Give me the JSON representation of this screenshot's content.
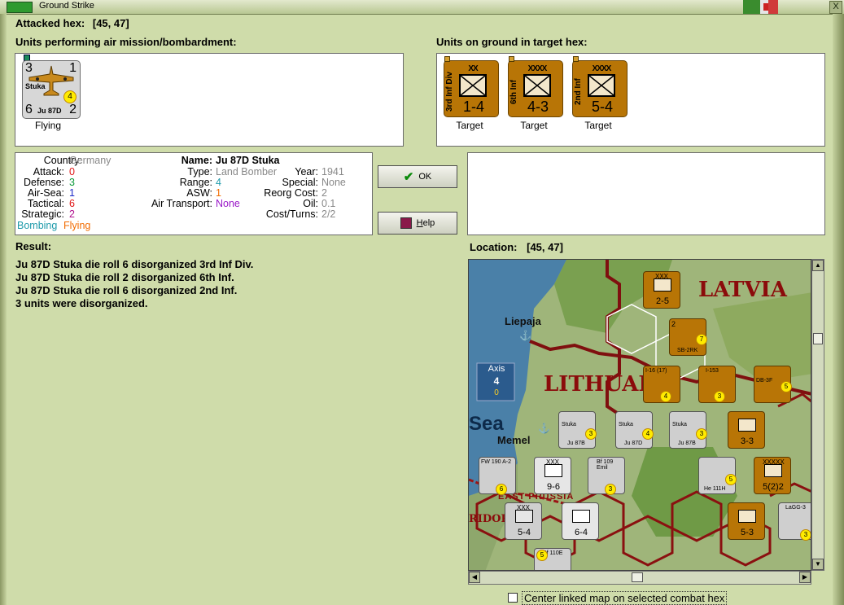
{
  "window": {
    "title": "Ground Strike",
    "close": "X"
  },
  "header": {
    "attacked_label": "Attacked hex:",
    "attacked_hex": "[45, 47]"
  },
  "air_panel": {
    "label": "Units performing air mission/bombardment:",
    "unit": {
      "name": "Stuka",
      "model": "Ju 87D",
      "top_left": "3",
      "top_right": "1",
      "bottom_left": "6",
      "bottom_right": "2",
      "range_badge": "4",
      "caption": "Flying"
    }
  },
  "ground_panel": {
    "label": "Units on ground in target hex:",
    "units": [
      {
        "side": "3rd Inf Div",
        "size": "XX",
        "strength": "1-4",
        "caption": "Target"
      },
      {
        "side": "6th Inf",
        "size": "XXXX",
        "strength": "4-3",
        "caption": "Target"
      },
      {
        "side": "2nd Inf",
        "size": "XXXX",
        "strength": "5-4",
        "caption": "Target"
      }
    ]
  },
  "info": {
    "country_label": "Country:",
    "country": "Germany",
    "attack_label": "Attack:",
    "attack": "0",
    "defense_label": "Defense:",
    "defense": "3",
    "airsea_label": "Air-Sea:",
    "airsea": "1",
    "tactical_label": "Tactical:",
    "tactical": "6",
    "strategic_label": "Strategic:",
    "strategic": "2",
    "status_a": "Bombing",
    "status_b": "Flying",
    "name_label": "Name:",
    "name": "Ju 87D Stuka",
    "type_label": "Type:",
    "type": "Land Bomber",
    "range_label": "Range:",
    "range": "4",
    "asw_label": "ASW:",
    "asw": "1",
    "airtransport_label": "Air Transport:",
    "airtransport": "None",
    "year_label": "Year:",
    "year": "1941",
    "special_label": "Special:",
    "special": "None",
    "reorg_label": "Reorg Cost:",
    "reorg": "2",
    "oil_label": "Oil:",
    "oil": "0.1",
    "cost_label": "Cost/Turns:",
    "cost": "2/2"
  },
  "buttons": {
    "ok": "OK",
    "help_h": "H",
    "help_rest": "elp"
  },
  "result": {
    "label": "Result:",
    "lines": [
      "Ju 87D Stuka die roll 6 disorganized 3rd Inf Div.",
      "Ju 87D Stuka die roll 2 disorganized 6th Inf.",
      "Ju 87D Stuka die roll 6 disorganized 2nd Inf.",
      "3 units were disorganized."
    ]
  },
  "location": {
    "label": "Location:",
    "hex": "[45, 47]"
  },
  "map": {
    "labels": {
      "latvia": "LATVIA",
      "lithuania": "LITHUAI",
      "sea": "Sea",
      "liepaja": "Liepaja",
      "memel": "Memel",
      "axis": "Axis",
      "axis_num": "4",
      "axis_zero": "0",
      "east_prussia": "EAST PRUSSIA",
      "corridor": "RIDOR"
    },
    "counters": [
      {
        "id": "c1",
        "top": "XXX",
        "val": "2-5"
      },
      {
        "id": "c2",
        "top": "2",
        "model": "SB-2RK",
        "badge": "7"
      },
      {
        "id": "c3",
        "model": "I-16 (17)",
        "badge": "4"
      },
      {
        "id": "c4",
        "model": "I-153",
        "badge": "3"
      },
      {
        "id": "c5",
        "model": "DB-3F",
        "badge": "5"
      },
      {
        "id": "c6",
        "name": "Stuka",
        "model": "Ju 87B",
        "badge": "3"
      },
      {
        "id": "c7",
        "name": "Stuka",
        "model": "Ju 87D",
        "badge": "4"
      },
      {
        "id": "c8",
        "name": "Stuka",
        "model": "Ju 87B",
        "badge": "3"
      },
      {
        "id": "c9",
        "val": "3-3"
      },
      {
        "id": "c10",
        "model": "FW 190 A-2",
        "badge": "6"
      },
      {
        "id": "c11",
        "top": "XXX",
        "val": "9-6"
      },
      {
        "id": "c12",
        "model": "Bf 109 Emil",
        "badge": "3"
      },
      {
        "id": "c13",
        "model": "He 111H",
        "badge": "5"
      },
      {
        "id": "c14",
        "top": "XXXXX",
        "val": "5(2)2"
      },
      {
        "id": "c15",
        "top": "XXX",
        "val": "5-4"
      },
      {
        "id": "c16",
        "val": "6-4"
      },
      {
        "id": "c17",
        "val": "5-3"
      },
      {
        "id": "c18",
        "model": "LaGG-3",
        "badge": "3"
      },
      {
        "id": "c19",
        "model": "Bf 110E",
        "badge": "5"
      }
    ]
  },
  "footer": {
    "center_label": "Center linked map on selected combat hex"
  }
}
